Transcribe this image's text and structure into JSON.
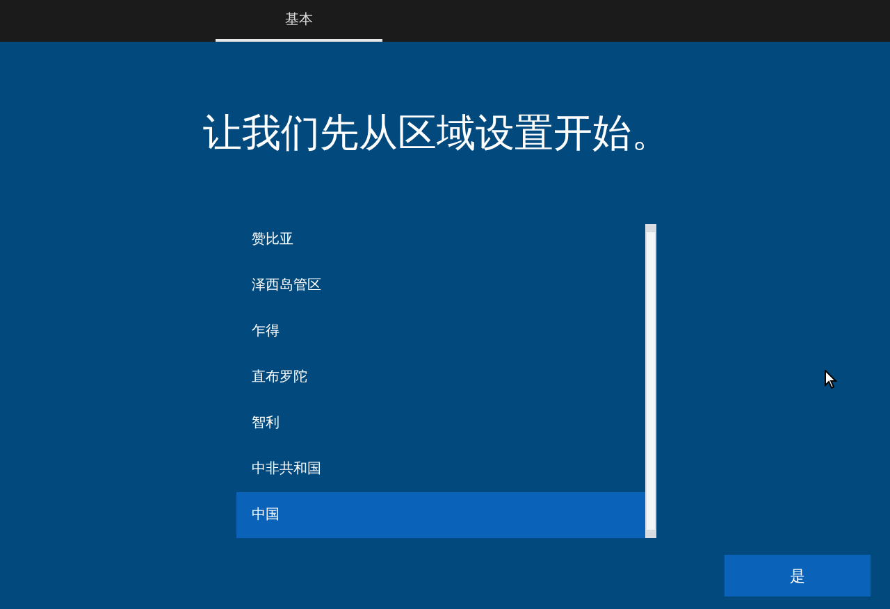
{
  "tabs": [
    {
      "label": "基本",
      "selected": true
    }
  ],
  "title": "让我们先从区域设置开始。",
  "regions": [
    {
      "label": "赞比亚",
      "selected": false
    },
    {
      "label": "泽西岛管区",
      "selected": false
    },
    {
      "label": "乍得",
      "selected": false
    },
    {
      "label": "直布罗陀",
      "selected": false
    },
    {
      "label": "智利",
      "selected": false
    },
    {
      "label": "中非共和国",
      "selected": false
    },
    {
      "label": "中国",
      "selected": true
    }
  ],
  "buttons": [
    "是"
  ]
}
